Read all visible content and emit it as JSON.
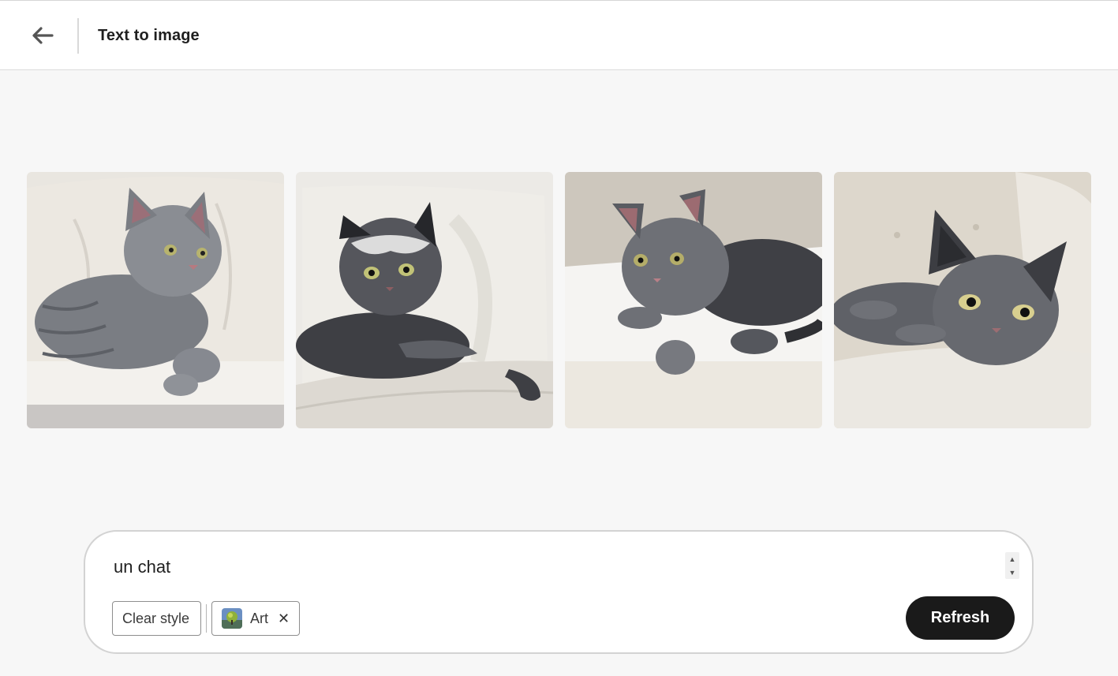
{
  "header": {
    "back_icon": "arrow-left-icon",
    "title": "Text to image"
  },
  "gallery": {
    "images": [
      {
        "alt": "grey tabby kitten on cream sofa"
      },
      {
        "alt": "grey kitten lying on armchair"
      },
      {
        "alt": "grey kitten lying on white cushion"
      },
      {
        "alt": "grey cat lying on tufted sofa"
      }
    ]
  },
  "prompt": {
    "value": "un chat",
    "chips": {
      "clear_label": "Clear style",
      "style_label": "Art",
      "remove_icon": "close-icon"
    },
    "refresh_label": "Refresh"
  },
  "colors": {
    "refresh_bg": "#1a1a1a",
    "page_bg": "#f7f7f7"
  }
}
